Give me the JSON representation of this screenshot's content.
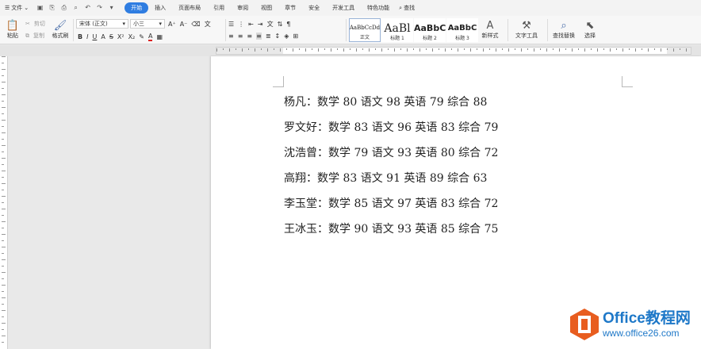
{
  "menubar": {
    "file_label": "文件",
    "tabs": [
      {
        "label": "开始",
        "active": true
      },
      {
        "label": "插入"
      },
      {
        "label": "页面布局"
      },
      {
        "label": "引用"
      },
      {
        "label": "审阅"
      },
      {
        "label": "视图"
      },
      {
        "label": "章节"
      },
      {
        "label": "安全"
      },
      {
        "label": "开发工具"
      },
      {
        "label": "特色功能"
      }
    ],
    "search_label": "查找"
  },
  "ribbon": {
    "paste": "粘贴",
    "cut": "剪切",
    "copy": "复制",
    "format_painter": "格式刷",
    "font_name": "宋体 (正文)",
    "font_size": "小三",
    "styles": [
      {
        "preview": "AaBbCcDd",
        "name": "正文",
        "selected": true
      },
      {
        "preview": "AaBl",
        "name": "标题 1"
      },
      {
        "preview": "AaBbC",
        "name": "标题 2"
      },
      {
        "preview": "AaBbC",
        "name": "标题 3"
      }
    ],
    "new_style": "新样式",
    "text_tools": "文字工具",
    "find_replace": "查找替换",
    "select": "选择"
  },
  "document": {
    "lines": [
      "杨凡：数学 80 语文 98 英语 79 综合 88",
      "罗文好：数学 83 语文 96 英语 83 综合 79",
      "沈浩曾：数学 79 语文 93 英语 80 综合 72",
      "高翔：数学 83 语文 91 英语 89 综合 63",
      "李玉堂：数学 85 语文 97 英语 83 综合 72",
      "王冰玉：数学 90 语文 93 英语 85 综合 75"
    ]
  },
  "watermark": {
    "title": "Office教程网",
    "url": "www.office26.com",
    "color": "#1e78c8",
    "accent": "#e85d1f"
  },
  "colors": {
    "accent": "#2f7de1"
  }
}
